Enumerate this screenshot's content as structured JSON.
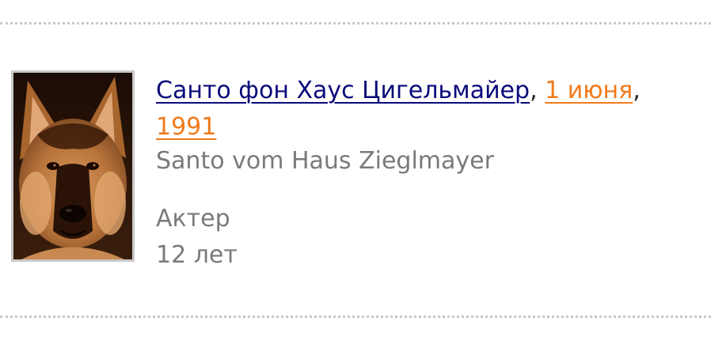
{
  "person": {
    "name": "Санто фон Хаус Цигельмайер",
    "comma_1": ",",
    "birth_day_month": "1 июня",
    "comma_2": ",",
    "birth_year": "1991",
    "original_name": "Santo vom Haus Zieglmayer",
    "occupation": "Актер",
    "age": "12 лет",
    "photo_icon": "german-shepherd-dog-photo"
  },
  "colors": {
    "name_link": "#0a0a7a",
    "date_link": "#f07a1a",
    "secondary_text": "#7a7a7a",
    "divider": "#c8c8c8"
  }
}
